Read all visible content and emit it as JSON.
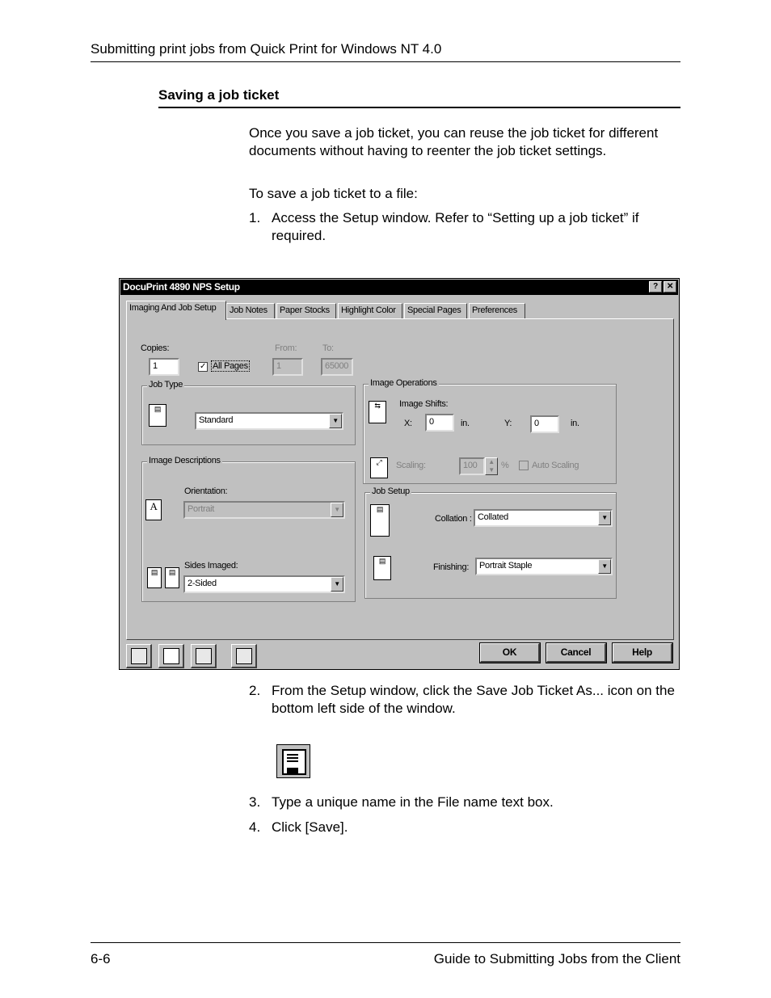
{
  "header": {
    "running_title": "Submitting print jobs from Quick Print for Windows NT 4.0"
  },
  "section": {
    "heading": "Saving a job ticket"
  },
  "body": {
    "intro": "Once you save a job ticket, you can reuse the job ticket for different documents without having to reenter the job ticket settings.",
    "lead": "To save a job ticket to a file:",
    "steps": [
      {
        "num": "1.",
        "text": "Access the Setup window.  Refer to “Setting up a job ticket” if required."
      },
      {
        "num": "2.",
        "text": "From the Setup window, click the Save Job Ticket As... icon on the bottom left side of the window."
      },
      {
        "num": "3.",
        "text": "Type a unique name in the File name text box."
      },
      {
        "num": "4.",
        "text": "Click [Save]."
      }
    ]
  },
  "dialog": {
    "title": "DocuPrint 4890 NPS Setup",
    "help_btn": "?",
    "close_btn": "✕",
    "tabs": [
      "Imaging And Job Setup",
      "Job Notes",
      "Paper Stocks",
      "Highlight Color",
      "Special Pages",
      "Preferences"
    ],
    "copies_label": "Copies:",
    "copies_value": "1",
    "all_pages_label": "All Pages",
    "from_label": "From:",
    "from_value": "1",
    "to_label": "To:",
    "to_value": "65000",
    "job_type_group": "Job Type",
    "job_type_value": "Standard",
    "image_desc_group": "Image Descriptions",
    "orientation_label": "Orientation:",
    "orientation_value": "Portrait",
    "sides_label": "Sides Imaged:",
    "sides_value": "2-Sided",
    "image_ops_group": "Image Operations",
    "image_shifts_label": "Image Shifts:",
    "x_label": "X:",
    "x_value": "0",
    "x_unit": "in.",
    "y_label": "Y:",
    "y_value": "0",
    "y_unit": "in.",
    "scaling_label": "Scaling:",
    "scaling_value": "100",
    "scaling_unit": "%",
    "auto_scaling_label": "Auto Scaling",
    "job_setup_group": "Job Setup",
    "collation_label": "Collation :",
    "collation_value": "Collated",
    "finishing_label": "Finishing:",
    "finishing_value": "Portrait Staple",
    "ok_label": "OK",
    "cancel_label": "Cancel",
    "help_label": "Help"
  },
  "footer": {
    "page_number": "6-6",
    "book_title": "Guide to Submitting Jobs from the Client"
  }
}
